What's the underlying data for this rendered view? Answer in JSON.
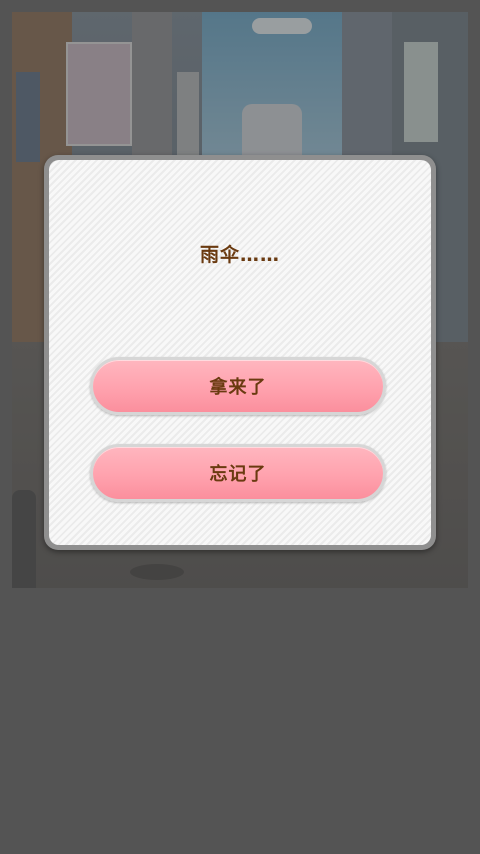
{
  "dialog": {
    "prompt": "雨伞……",
    "choices": [
      {
        "label": "拿来了"
      },
      {
        "label": "忘记了"
      }
    ]
  },
  "colors": {
    "button_fill": "#ffa2ae",
    "text": "#6a3a10",
    "dialog_bg": "#f6f6f6"
  }
}
